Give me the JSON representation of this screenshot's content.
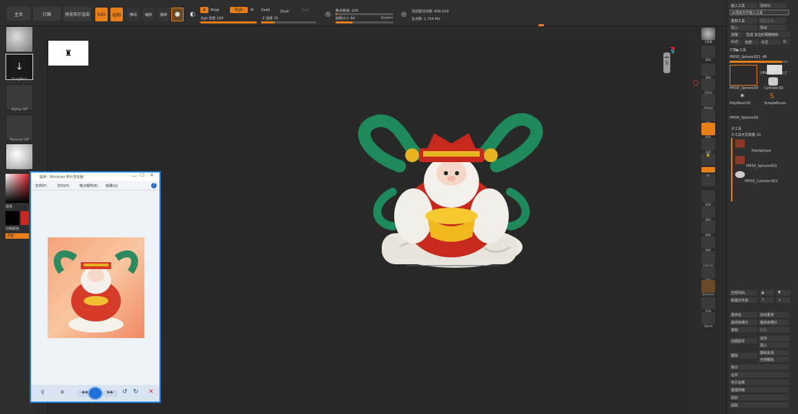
{
  "topbar": {
    "home": "主页",
    "lightbox": "灯箱",
    "preview_render": "预览布尔渲染",
    "edit": "Edit",
    "draw": "绘制",
    "move": "移动",
    "scale": "缩放",
    "rotate": "旋转",
    "a_label": "A",
    "mrgb": "Mrgb",
    "rgb": "Rgb",
    "m": "M",
    "rgb_strength": "Rgb 强度 100",
    "zadd": "Zadd",
    "zsub": "Zsub",
    "zcut": "Zcut",
    "z_strength": "Z 强度 25",
    "focal_shift": "焦点衰减 -100",
    "draw_size": "绘制大小 64",
    "dynamic": "Dynamic",
    "active_points": "当前激活点数: 604,019",
    "total_points": "总点数: 1.754 Mil"
  },
  "leftbar": {
    "paint": "Paint",
    "dragrect": "DragRect",
    "alpha_off": "Alpha Off",
    "texture_off": "Texture Off",
    "skinshade": "SkinShade4",
    "gradient": "渐变",
    "switch_color": "切换颜色",
    "swap": "交替"
  },
  "rightstrip": {
    "sub_tool": "子像素",
    "scroll": "滚动",
    "zoom": "缩放",
    "actual": "100%",
    "half": "AAHalf",
    "persp": "透视",
    "floor": "地面",
    "local": "局部",
    "frame": "框架",
    "move": "移动",
    "zoom3d": "缩放",
    "rotate": "旋转",
    "transp": "透明",
    "ghost": "幽灵",
    "solo": "Solo",
    "xpose": "Xpose",
    "line_fill": "Line Fill",
    "polyf": "PolyF",
    "dynamic_persp": "Dynamic"
  },
  "rightpanel": {
    "load_tool": "载入工具",
    "save_as": "另存为",
    "load_from_project": "从项目文件载入工具",
    "copy_tool": "复制工具",
    "paste_tool": "粘贴工具",
    "import": "导入",
    "export": "导出",
    "clone": "克隆",
    "make_polymesh": "生成 多边形网格物体",
    "goz": "GoZ",
    "all": "全部",
    "visible": "可见",
    "r": "R",
    "lightbox_tools": "灯箱▶工具",
    "current_tool": "PM3D_Sphere3D2_48",
    "tool_count": "48",
    "tools": [
      {
        "name": "PM3D_Sphere3D"
      },
      {
        "name": "UMesh_PM3D_C"
      },
      {
        "name": "Cylinder3D"
      },
      {
        "name": "PolyMesh3D"
      },
      {
        "name": "SimpleBrush"
      },
      {
        "name": "PM3D_Sphere3D"
      }
    ],
    "subtool_header": "子工具",
    "subtool_count": "子工具可见数量 10",
    "subtools": [
      {
        "name": "PolySphere"
      },
      {
        "name": "PM3D_Sphere3D2"
      },
      {
        "name": "PM3D_Cylinder3D1"
      }
    ],
    "list_all": "全部列出",
    "new_folder": "新建文件夹",
    "rename": "重命名",
    "auto_reorder": "自动重排",
    "lowest_res": "最低级细分",
    "highest_res": "最高级细分",
    "copy": "复制",
    "paste": "粘贴",
    "duplicate": "创建副本",
    "append": "追加",
    "insert": "插入",
    "delete": "删除",
    "delete_other": "删除其他",
    "delete_all": "全部删除",
    "split": "拆分",
    "merge": "合并",
    "boolean": "布尔运算",
    "remesh": "重建网格",
    "project": "投射",
    "extract": "提取"
  },
  "viewer": {
    "title": "福神 - Windows 照片查看器",
    "menu": [
      "文件(F)",
      "打印(P)",
      "电子邮件(E)",
      "刻录(U)"
    ],
    "help": "?"
  }
}
